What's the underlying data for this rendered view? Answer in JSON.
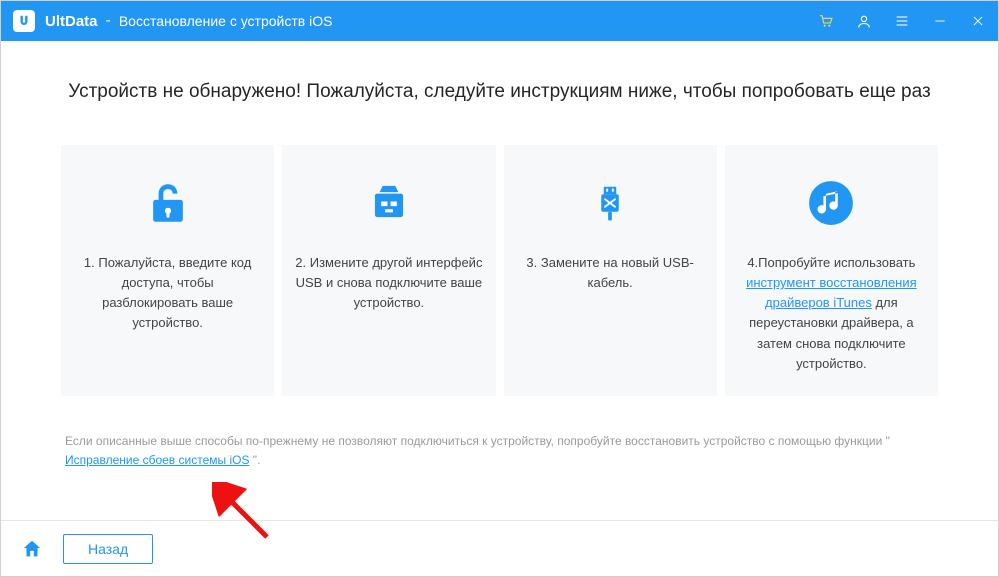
{
  "titlebar": {
    "app_name": "UltData",
    "separator": "-",
    "subtitle": "Восстановление с устройств iOS"
  },
  "heading": "Устройств не обнаружено! Пожалуйста, следуйте инструкциям ниже, чтобы попробовать еще раз",
  "cards": {
    "c1": "1. Пожалуйста, введите код доступа, чтобы разблокировать ваше устройство.",
    "c2": "2. Измените другой интерфейс USB и снова подключите ваше устройство.",
    "c3": "3. Замените на новый USB-кабель.",
    "c4_pre": "4.Попробуйте использовать ",
    "c4_link": "инструмент восстановления драйверов iTunes",
    "c4_post": "  для переустановки драйвера, а затем снова подключите устройство."
  },
  "footnote": {
    "pre": "Если описанные выше способы по-прежнему не позволяют подключиться к устройству, попробуйте восстановить устройство с помощью функции \" ",
    "link": "Исправление сбоев системы iOS",
    "post": " \"."
  },
  "bottom": {
    "back": "Назад"
  },
  "colors": {
    "accent": "#2196f3"
  }
}
